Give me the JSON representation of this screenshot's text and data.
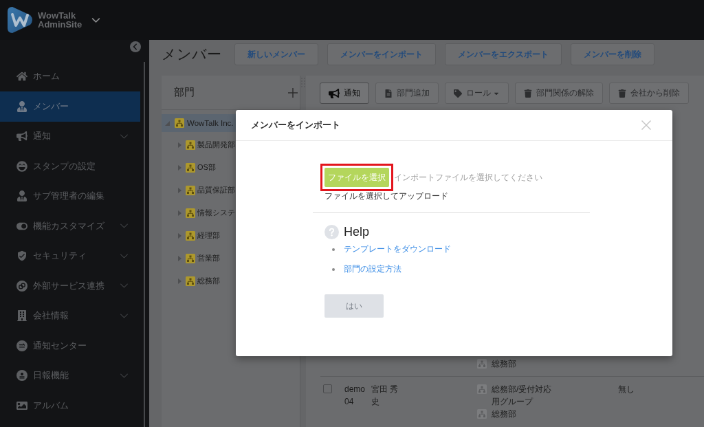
{
  "brand": {
    "name": "WowTalk",
    "subtitle": "AdminSite"
  },
  "sidebar": {
    "items": [
      {
        "label": "ホーム",
        "selected": false,
        "submenu": false
      },
      {
        "label": "メンバー",
        "selected": true,
        "submenu": false
      },
      {
        "label": "通知",
        "selected": false,
        "submenu": true
      },
      {
        "label": "スタンプの設定",
        "selected": false,
        "submenu": false
      },
      {
        "label": "サブ管理者の編集",
        "selected": false,
        "submenu": false
      },
      {
        "label": "機能カスタマイズ",
        "selected": false,
        "submenu": true
      },
      {
        "label": "セキュリティ",
        "selected": false,
        "submenu": true
      },
      {
        "label": "外部サービス連携",
        "selected": false,
        "submenu": true
      },
      {
        "label": "会社情報",
        "selected": false,
        "submenu": true
      },
      {
        "label": "通知センター",
        "selected": false,
        "submenu": false
      },
      {
        "label": "日報機能",
        "selected": false,
        "submenu": true
      },
      {
        "label": "アルバム",
        "selected": false,
        "submenu": false
      }
    ]
  },
  "page": {
    "title": "メンバー",
    "actions": [
      "新しいメンバー",
      "メンバーをインポート",
      "メンバーをエクスポート",
      "メンバーを削除"
    ]
  },
  "departments": {
    "title": "部門",
    "tree": [
      {
        "label": "WowTalk Inc.",
        "selected": true,
        "expanded": true,
        "children": [
          {
            "label": "製品開発部",
            "selected": false,
            "expanded": false
          },
          {
            "label": "OS部",
            "selected": false,
            "expanded": false
          },
          {
            "label": "品質保証部",
            "selected": false,
            "expanded": false
          },
          {
            "label": "情報システ",
            "selected": false,
            "expanded": false
          },
          {
            "label": "経理部",
            "selected": false,
            "expanded": false
          },
          {
            "label": "営業部",
            "selected": false,
            "expanded": false
          },
          {
            "label": "総務部",
            "selected": false,
            "expanded": false
          }
        ]
      }
    ]
  },
  "toolbar": [
    {
      "kind": "button",
      "label": "通知",
      "disabled": false
    },
    {
      "kind": "button",
      "label": "部門追加",
      "disabled": true
    },
    {
      "kind": "dropdown",
      "label": "ロール",
      "disabled": true
    },
    {
      "kind": "button",
      "label": "部門関係の解除",
      "disabled": true
    },
    {
      "kind": "button",
      "label": "会社から削除",
      "disabled": true
    }
  ],
  "members": {
    "rows": [
      {
        "departments": [
          "総務部"
        ]
      },
      {
        "checked": false,
        "id": "demo04",
        "name": "宮田 秀史",
        "departments": [
          "総務部/受付対応用グループ",
          "総務部"
        ],
        "column_4": "無し"
      }
    ]
  },
  "modal": {
    "title": "メンバーをインポート",
    "file_button": {
      "label": "ファイルを選択",
      "highlighted": true
    },
    "file_field": {
      "placeholder": "インポートファイルを選択してください"
    },
    "hint": "ファイルを選択してアップロード",
    "help": {
      "title": "Help",
      "links": [
        "テンプレートをダウンロード",
        "部門の設定方法"
      ]
    },
    "submit": {
      "label": "はい",
      "disabled": true
    }
  }
}
